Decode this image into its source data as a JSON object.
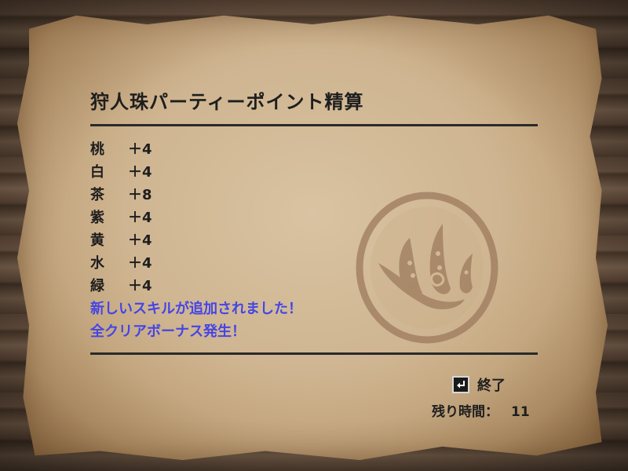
{
  "title": "狩人珠パーティーポイント精算",
  "points": [
    {
      "color": "桃",
      "value": "＋4"
    },
    {
      "color": "白",
      "value": "＋4"
    },
    {
      "color": "茶",
      "value": "＋8"
    },
    {
      "color": "紫",
      "value": "＋4"
    },
    {
      "color": "黄",
      "value": "＋4"
    },
    {
      "color": "水",
      "value": "＋4"
    },
    {
      "color": "緑",
      "value": "＋4"
    }
  ],
  "messages": {
    "skill_added": "新しいスキルが追加されました！",
    "all_clear_bonus": "全クリアボーナス発生！"
  },
  "controls": {
    "exit_label": "終了",
    "exit_icon": "enter-key-icon"
  },
  "timer": {
    "label": "残り時間：",
    "value": "11"
  },
  "colors": {
    "text": "#1e1e1e",
    "highlight": "#4545e6",
    "parchment": "#cfb591"
  }
}
